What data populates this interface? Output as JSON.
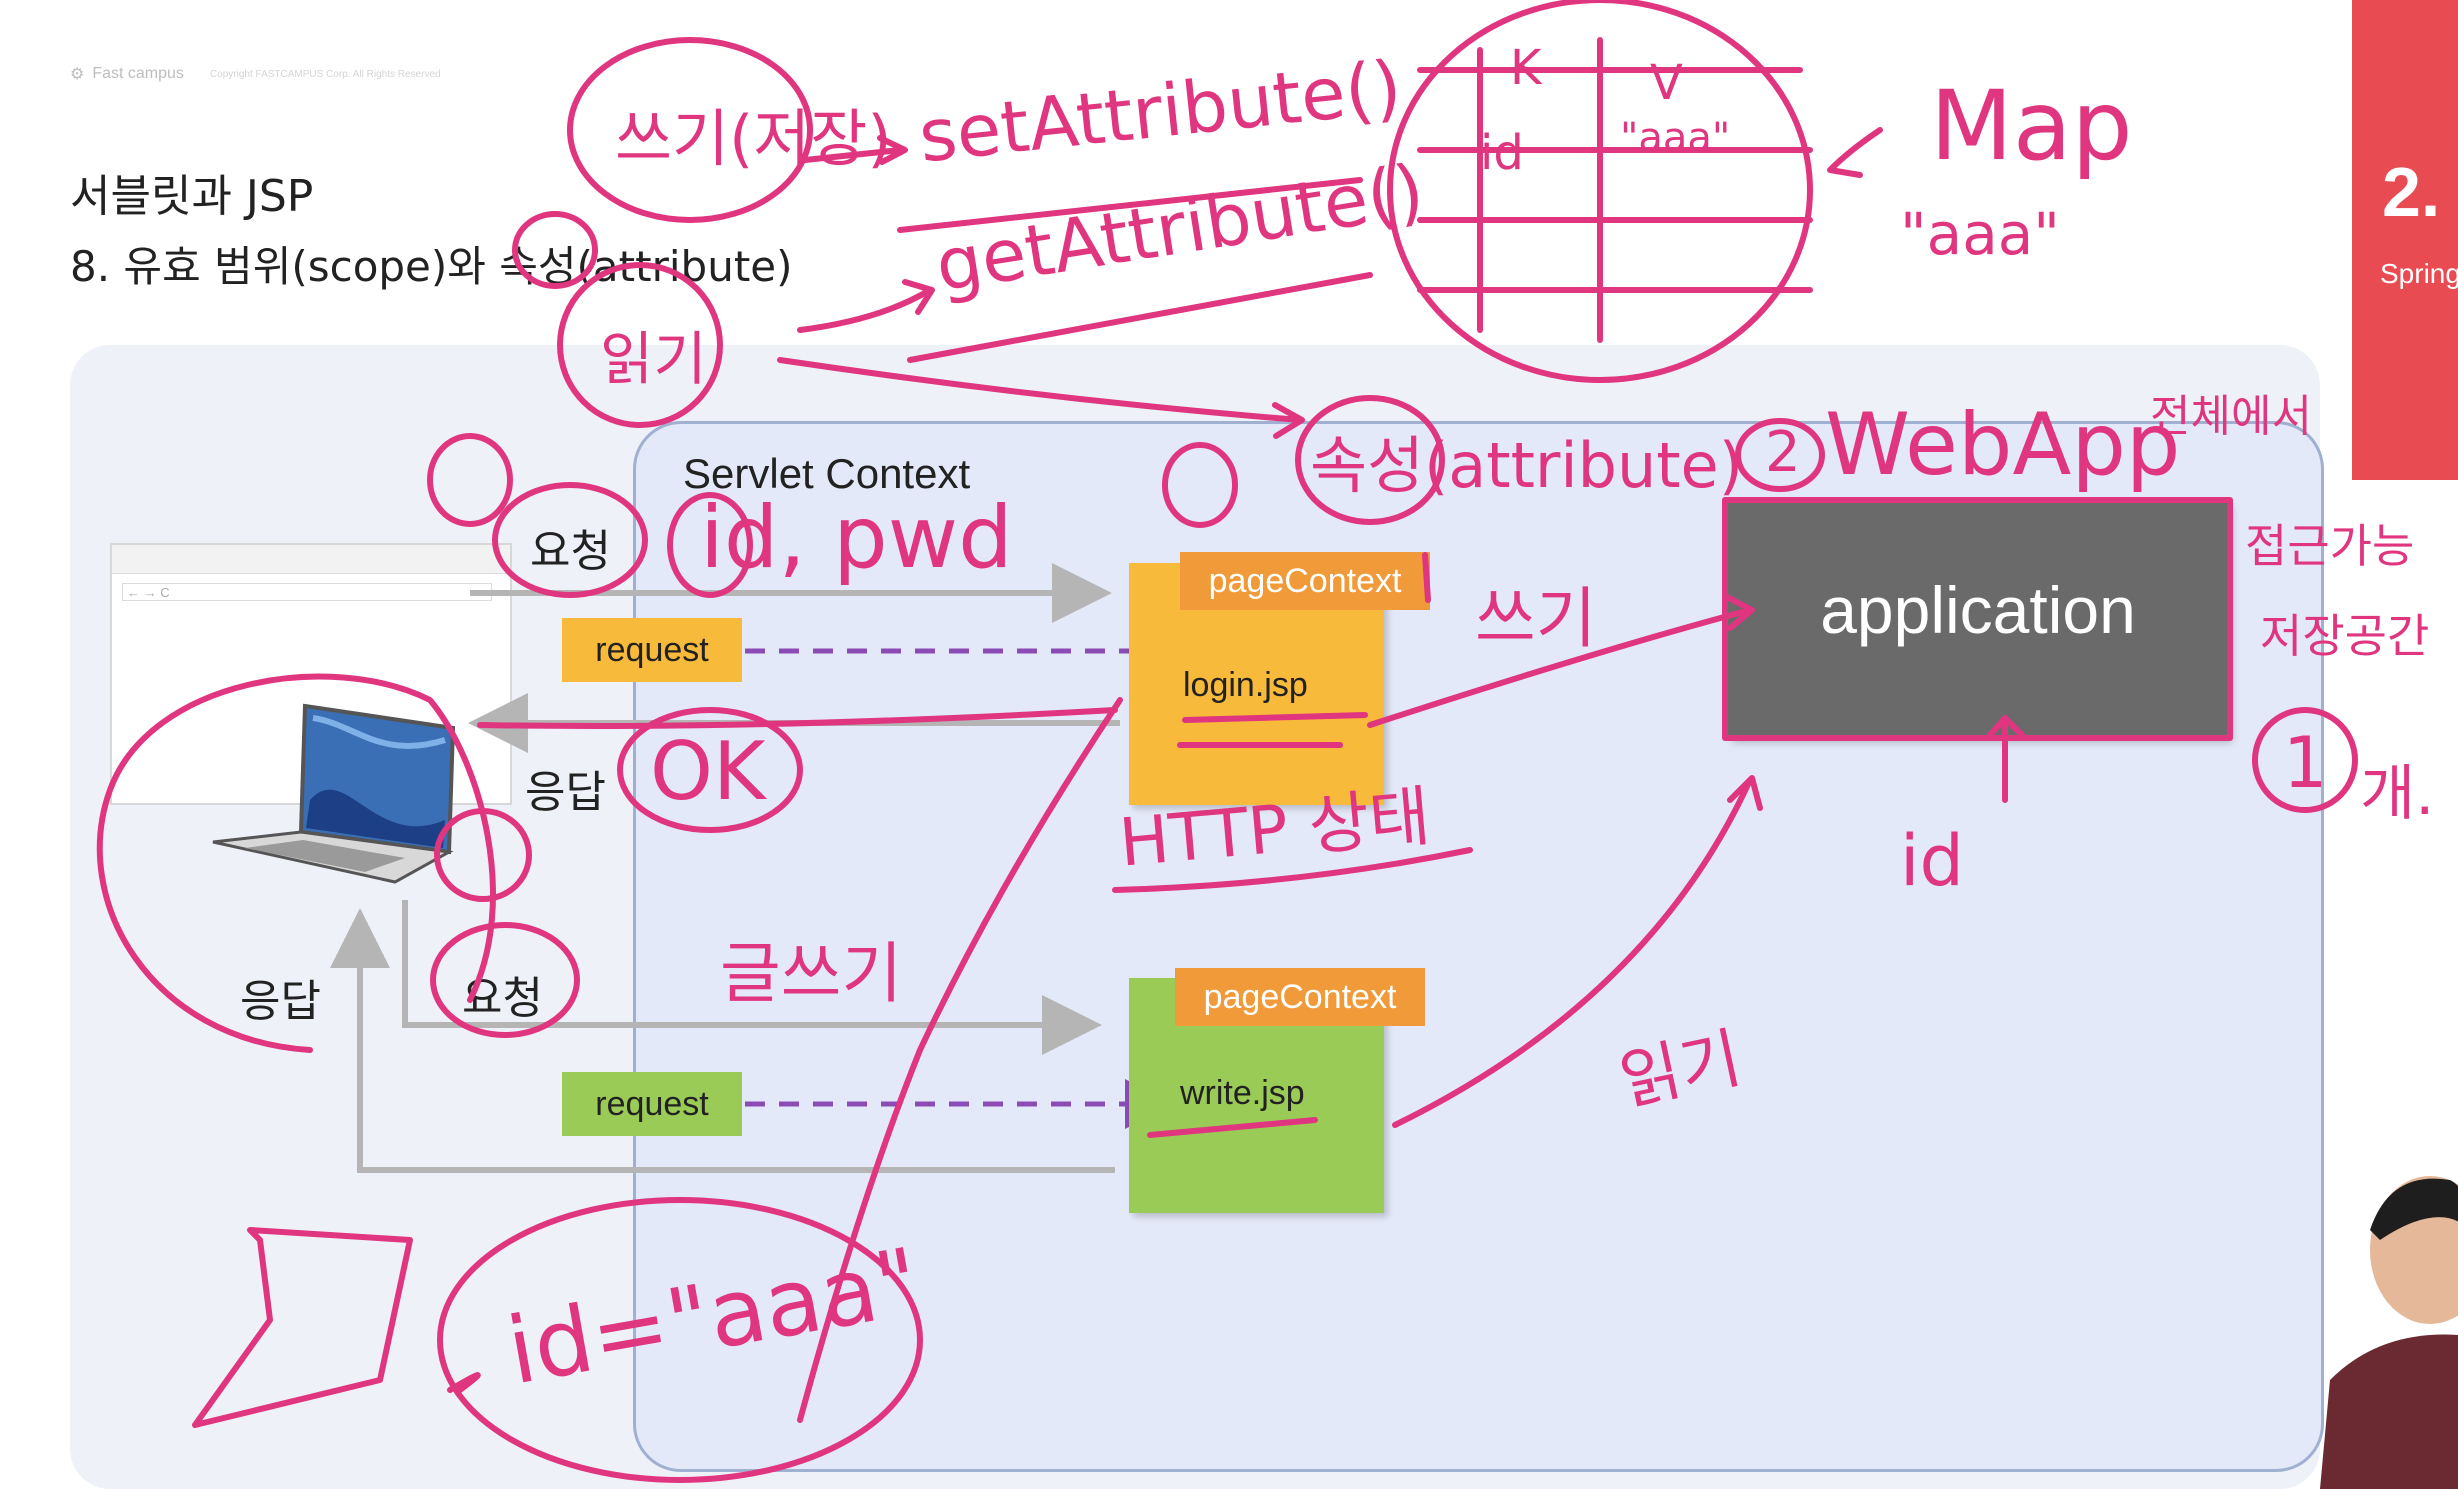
{
  "header": {
    "logo_text": "Fast campus",
    "copyright": "Copyright FASTCAMPUS Corp. All Rights Reserved",
    "title": "서블릿과 JSP",
    "subtitle": "8. 유효 범위(scope)와 속성(attribute)"
  },
  "chapter_tab": {
    "number": "2.",
    "label": "Spring"
  },
  "diagram": {
    "context_label": "Servlet Context",
    "request_label": "요청",
    "response_label": "응답",
    "request_tag": "request",
    "page_context": "pageContext",
    "login_page": "login.jsp",
    "write_page": "write.jsp",
    "application": "application"
  },
  "colors": {
    "accent_red": "#e84b52",
    "ink": "#e0357f",
    "orange": "#f8ba3a",
    "green": "#9bcb57",
    "page_context": "#f09a3a",
    "application": "#6a6a6a"
  },
  "annotations": {
    "write": "쓰기(저장)",
    "read": "읽기",
    "set": "setAttribute()",
    "get": "getAttribute()",
    "map": "Map",
    "map_key": "K",
    "map_value": "V",
    "map_id": "id",
    "map_val": "\"aaa\"",
    "aaa": "\"aaa\"",
    "attribute": "속성(attribute)",
    "two": "2",
    "webapp": "WebApp",
    "webapp_tail": "전체에서",
    "access": "접근가능",
    "storage": "저장공간",
    "one": "1",
    "one_count": "개.",
    "id_pwd": "id, pwd",
    "ok": "OK",
    "http": "HTTP 상태",
    "write_short": "쓰기",
    "write_post": "글쓰기",
    "read_short": "읽기",
    "id_label": "id",
    "id_aaa": "id=\"aaa\""
  }
}
